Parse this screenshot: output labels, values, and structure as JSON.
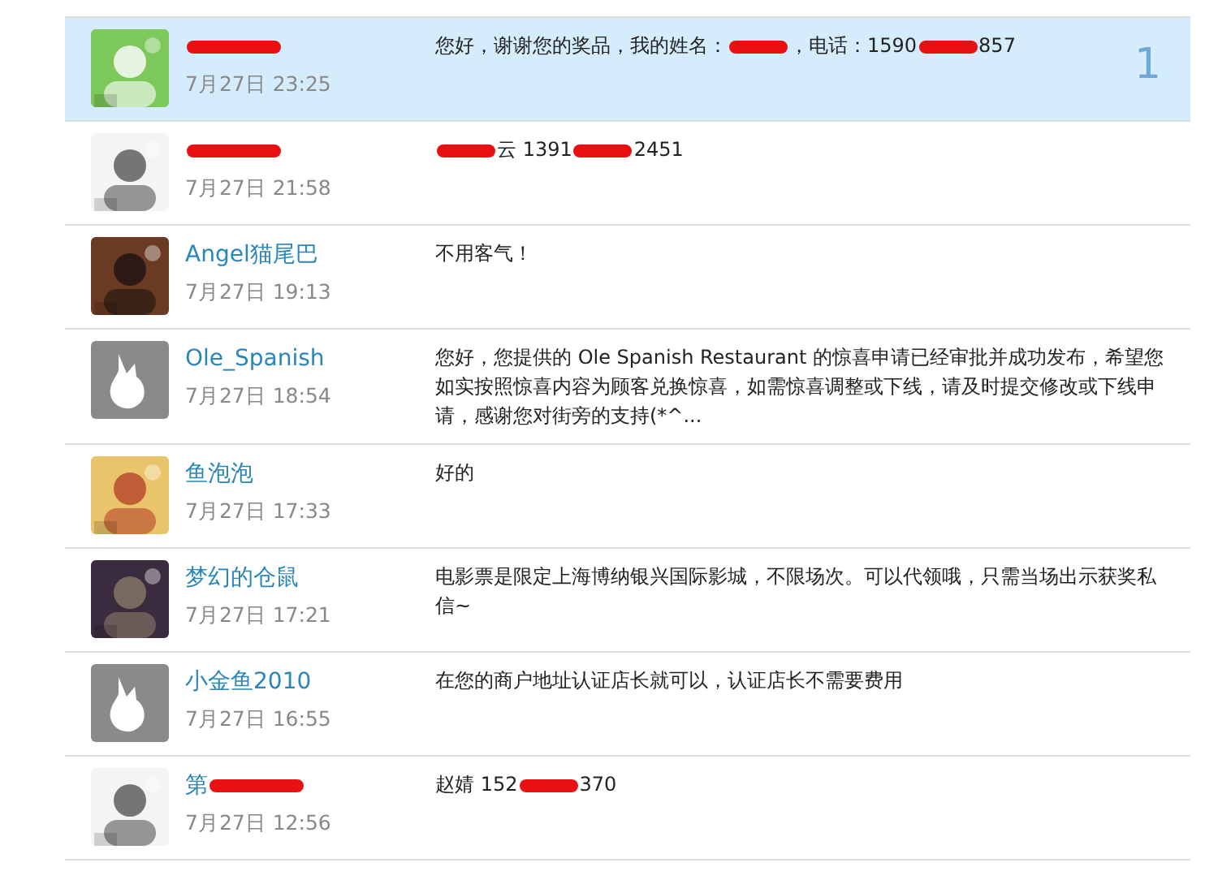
{
  "messages": [
    {
      "selected": true,
      "avatar": {
        "kind": "picture"
      },
      "name": [
        {
          "kind": "redacted"
        }
      ],
      "date": "7月27日 23:25",
      "text": [
        {
          "kind": "text",
          "text": "您好，谢谢您的奖品，我的姓名："
        },
        {
          "kind": "redacted"
        },
        {
          "kind": "text",
          "text": "，电话：1590"
        },
        {
          "kind": "redacted"
        },
        {
          "kind": "text",
          "text": "857"
        }
      ],
      "count": "1"
    },
    {
      "selected": false,
      "avatar": {
        "kind": "picture"
      },
      "name": [
        {
          "kind": "redacted"
        }
      ],
      "date": "7月27日 21:58",
      "text": [
        {
          "kind": "redacted"
        },
        {
          "kind": "text",
          "text": "云 1391"
        },
        {
          "kind": "redacted"
        },
        {
          "kind": "text",
          "text": "2451"
        }
      ]
    },
    {
      "selected": false,
      "avatar": {
        "kind": "picture"
      },
      "name": [
        {
          "kind": "text",
          "text": "Angel猫尾巴"
        }
      ],
      "date": "7月27日 19:13",
      "text": [
        {
          "kind": "text",
          "text": "不用客气！"
        }
      ]
    },
    {
      "selected": false,
      "avatar": {
        "kind": "default"
      },
      "name": [
        {
          "kind": "text",
          "text": "Ole_Spanish"
        }
      ],
      "date": "7月27日 18:54",
      "text": [
        {
          "kind": "text",
          "text": "您好，您提供的 Ole Spanish Restaurant 的惊喜申请已经审批并成功发布，希望您如实按照惊喜内容为顾客兑换惊喜，如需惊喜调整或下线，请及时提交修改或下线申请，感谢您对街旁的支持(*^..."
        }
      ]
    },
    {
      "selected": false,
      "avatar": {
        "kind": "picture"
      },
      "name": [
        {
          "kind": "text",
          "text": "鱼泡泡"
        }
      ],
      "date": "7月27日 17:33",
      "text": [
        {
          "kind": "text",
          "text": "好的"
        }
      ]
    },
    {
      "selected": false,
      "avatar": {
        "kind": "picture"
      },
      "name": [
        {
          "kind": "text",
          "text": "梦幻的仓鼠"
        }
      ],
      "date": "7月27日 17:21",
      "text": [
        {
          "kind": "text",
          "text": "电影票是限定上海博纳银兴国际影城，不限场次。可以代领哦，只需当场出示获奖私信~"
        }
      ]
    },
    {
      "selected": false,
      "avatar": {
        "kind": "default"
      },
      "name": [
        {
          "kind": "text",
          "text": "小金鱼2010"
        }
      ],
      "date": "7月27日 16:55",
      "text": [
        {
          "kind": "text",
          "text": "在您的商户地址认证店长就可以，认证店长不需要费用"
        }
      ]
    },
    {
      "selected": false,
      "avatar": {
        "kind": "picture"
      },
      "name": [
        {
          "kind": "text",
          "text": "第"
        },
        {
          "kind": "redacted"
        }
      ],
      "date": "7月27日 12:56",
      "text": [
        {
          "kind": "text",
          "text": "赵婧 152"
        },
        {
          "kind": "redacted"
        },
        {
          "kind": "text",
          "text": "370"
        }
      ]
    }
  ]
}
